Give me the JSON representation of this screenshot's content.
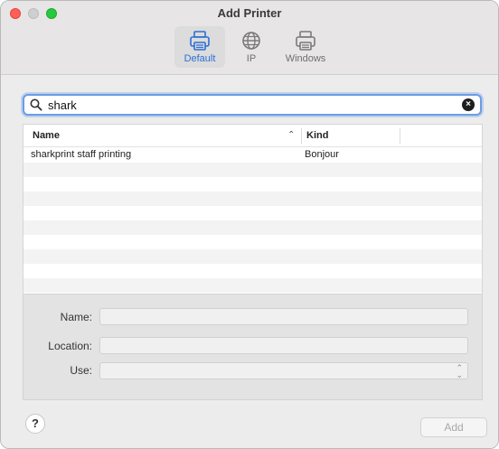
{
  "window": {
    "title": "Add Printer"
  },
  "toolbar": {
    "items": [
      {
        "label": "Default",
        "icon": "printer-icon",
        "selected": true
      },
      {
        "label": "IP",
        "icon": "globe-icon",
        "selected": false
      },
      {
        "label": "Windows",
        "icon": "windows-printer-icon",
        "selected": false
      }
    ]
  },
  "search": {
    "value": "shark"
  },
  "table": {
    "columns": [
      "Name",
      "Kind"
    ],
    "rows": [
      {
        "name": "sharkprint staff printing",
        "kind": "Bonjour"
      }
    ]
  },
  "form": {
    "name_label": "Name:",
    "name_value": "",
    "location_label": "Location:",
    "location_value": "",
    "use_label": "Use:",
    "use_value": ""
  },
  "footer": {
    "help_label": "?",
    "add_label": "Add"
  },
  "colors": {
    "accent": "#2c6fd6",
    "close": "#fe5f57",
    "maximize": "#28c840"
  }
}
